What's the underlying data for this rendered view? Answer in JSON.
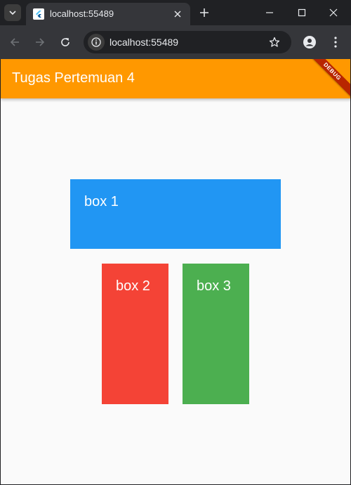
{
  "browser": {
    "tab_title": "localhost:55489",
    "url": "localhost:55489"
  },
  "app": {
    "title": "Tugas Pertemuan 4",
    "appbar_color": "#ff9800",
    "debug_banner": "DEBUG"
  },
  "boxes": [
    {
      "label": "box 1",
      "color": "#2196f3"
    },
    {
      "label": "box 2",
      "color": "#f44336"
    },
    {
      "label": "box 3",
      "color": "#4caf50"
    }
  ]
}
